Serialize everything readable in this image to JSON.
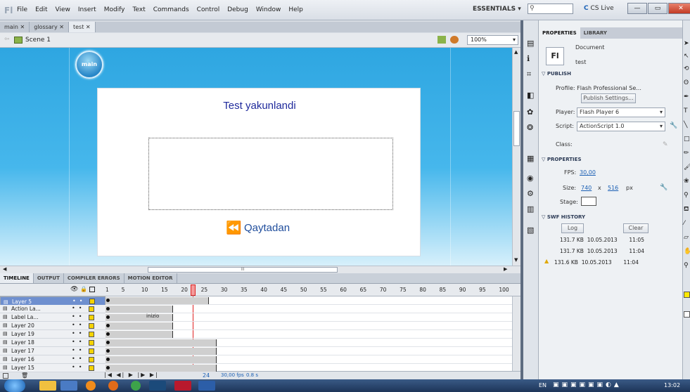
{
  "menubar": {
    "logo": "Fl",
    "items": [
      "File",
      "Edit",
      "View",
      "Insert",
      "Modify",
      "Text",
      "Commands",
      "Control",
      "Debug",
      "Window",
      "Help"
    ],
    "workspace": "ESSENTIALS ▾",
    "search_placeholder": "",
    "cs_live": "CS Live",
    "win_min": "—",
    "win_max": "▭",
    "win_close": "✕"
  },
  "doc_tabs": [
    {
      "label": "main",
      "close": "✕"
    },
    {
      "label": "glossary",
      "close": "✕"
    },
    {
      "label": "test",
      "close": "✕"
    }
  ],
  "scene": {
    "label": "Scene 1",
    "zoom": "100%"
  },
  "stage": {
    "main_button": "main",
    "title": "Test yakunlandi",
    "retry": "Qaytadan",
    "hscroll_mark": "III"
  },
  "timeline_tabs": [
    "TIMELINE",
    "OUTPUT",
    "COMPILER ERRORS",
    "MOTION EDITOR"
  ],
  "timeline": {
    "frame_numbers": [
      "1",
      "5",
      "10",
      "15",
      "20",
      "25",
      "30",
      "35",
      "40",
      "45",
      "50",
      "55",
      "60",
      "65",
      "70",
      "75",
      "80",
      "85",
      "90",
      "95",
      "100"
    ],
    "playhead_frame": "24",
    "layers": [
      "Layer 5",
      "Action La...",
      "Label La...",
      "Layer 20",
      "Layer 19",
      "Layer 18",
      "Layer 17",
      "Layer 16",
      "Layer 15"
    ],
    "label_text": "inizio",
    "footer": {
      "frame": "24",
      "fps": "30,00 fps",
      "time": "0.8 s"
    }
  },
  "properties": {
    "tabs": [
      "PROPERTIES",
      "LIBRARY"
    ],
    "doc_icon": "Fl",
    "doc_type": "Document",
    "doc_name": "test",
    "publish_section": "PUBLISH",
    "profile_label": "Profile: Flash Professional Se...",
    "publish_settings": "Publish Settings...",
    "player_label": "Player:",
    "player_value": "Flash Player 6",
    "script_label": "Script:",
    "script_value": "ActionScript 1.0",
    "class_label": "Class:",
    "properties_section": "PROPERTIES",
    "fps_label": "FPS:",
    "fps_value": "30,00",
    "size_label": "Size:",
    "size_w": "740",
    "size_x": "x",
    "size_h": "516",
    "size_unit": "px",
    "stage_label": "Stage:",
    "swf_section": "SWF HISTORY",
    "log_btn": "Log",
    "clear_btn": "Clear",
    "history": [
      {
        "size": "131.7 KB",
        "date": "10.05.2013",
        "time": "11:05"
      },
      {
        "size": "131.7 KB",
        "date": "10.05.2013",
        "time": "11:04"
      },
      {
        "size": "131.6 KB",
        "date": "10.05.2013",
        "time": "11:04"
      }
    ]
  },
  "taskbar": {
    "lang": "EN",
    "clock": "13:02"
  },
  "colors": {
    "stage_top": "#2ea6e1",
    "accent": "#1a5fb4",
    "title_text": "#1f2a9c",
    "playhead": "#e02020"
  }
}
